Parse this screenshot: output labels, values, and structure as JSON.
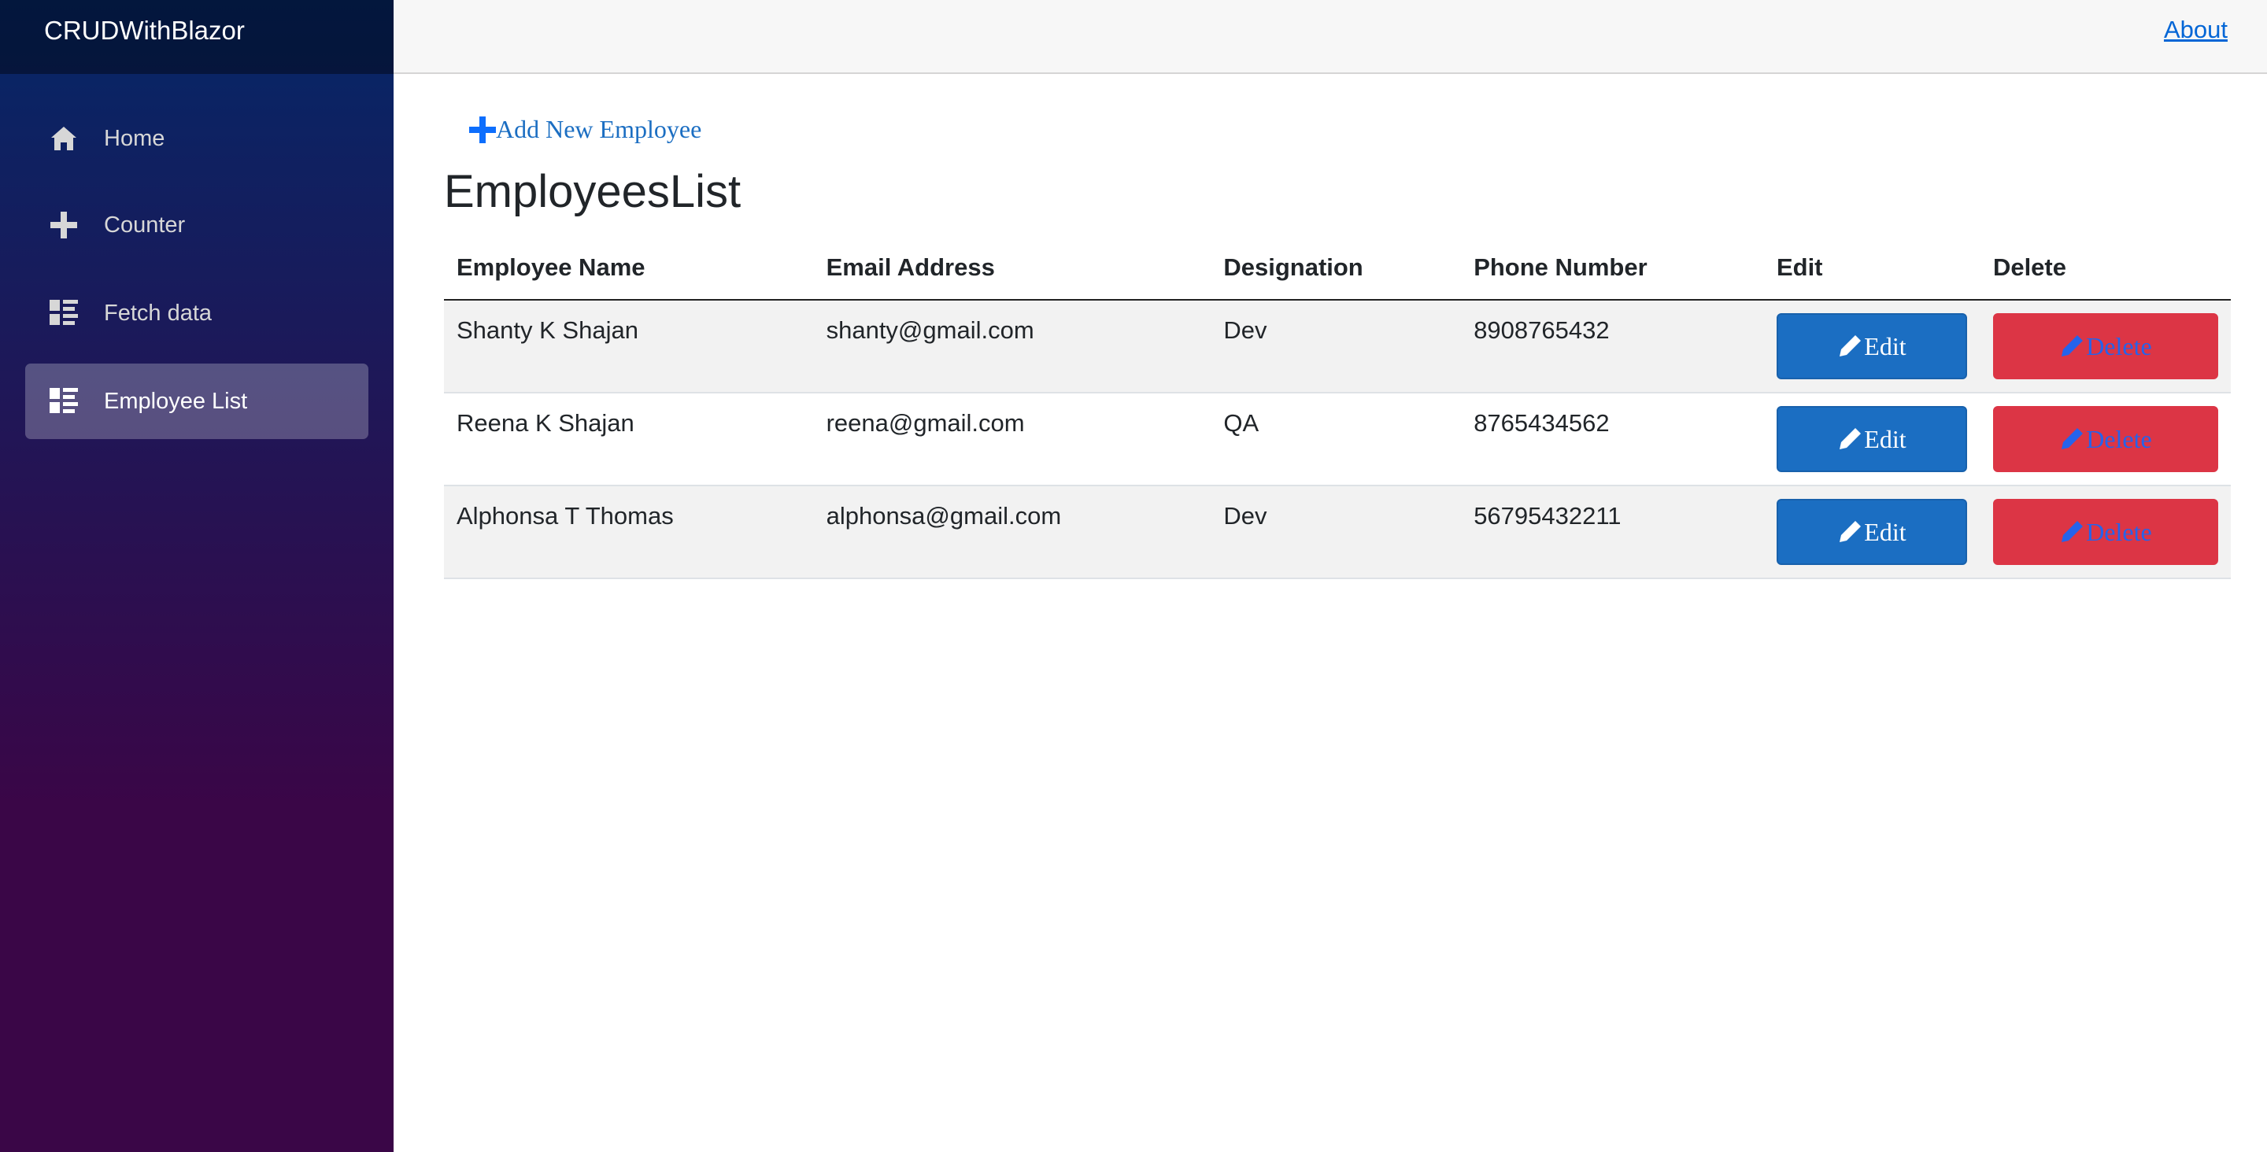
{
  "app": {
    "brand": "CRUDWithBlazor"
  },
  "sidebar": {
    "items": [
      {
        "label": "Home",
        "icon": "home-icon",
        "active": false
      },
      {
        "label": "Counter",
        "icon": "plus-icon",
        "active": false
      },
      {
        "label": "Fetch data",
        "icon": "list-icon",
        "active": false
      },
      {
        "label": "Employee List",
        "icon": "list-icon",
        "active": true
      }
    ]
  },
  "header": {
    "about_label": "About"
  },
  "main": {
    "add_link_label": "Add New Employee",
    "title": "EmployeesList",
    "table": {
      "columns": [
        "Employee Name",
        "Email Address",
        "Designation",
        "Phone Number",
        "Edit",
        "Delete"
      ],
      "rows": [
        {
          "name": "Shanty K Shajan",
          "email": "shanty@gmail.com",
          "designation": "Dev",
          "phone": "8908765432"
        },
        {
          "name": "Reena K Shajan",
          "email": "reena@gmail.com",
          "designation": "QA",
          "phone": "8765434562"
        },
        {
          "name": "Alphonsa T Thomas",
          "email": "alphonsa@gmail.com",
          "designation": "Dev",
          "phone": "56795432211"
        }
      ],
      "edit_label": "Edit",
      "delete_label": "Delete"
    }
  },
  "colors": {
    "primary": "#1b6ec2",
    "danger": "#dc3545",
    "sidebar_top": "#052767",
    "sidebar_bottom": "#3a0647",
    "link": "#0366d6"
  }
}
